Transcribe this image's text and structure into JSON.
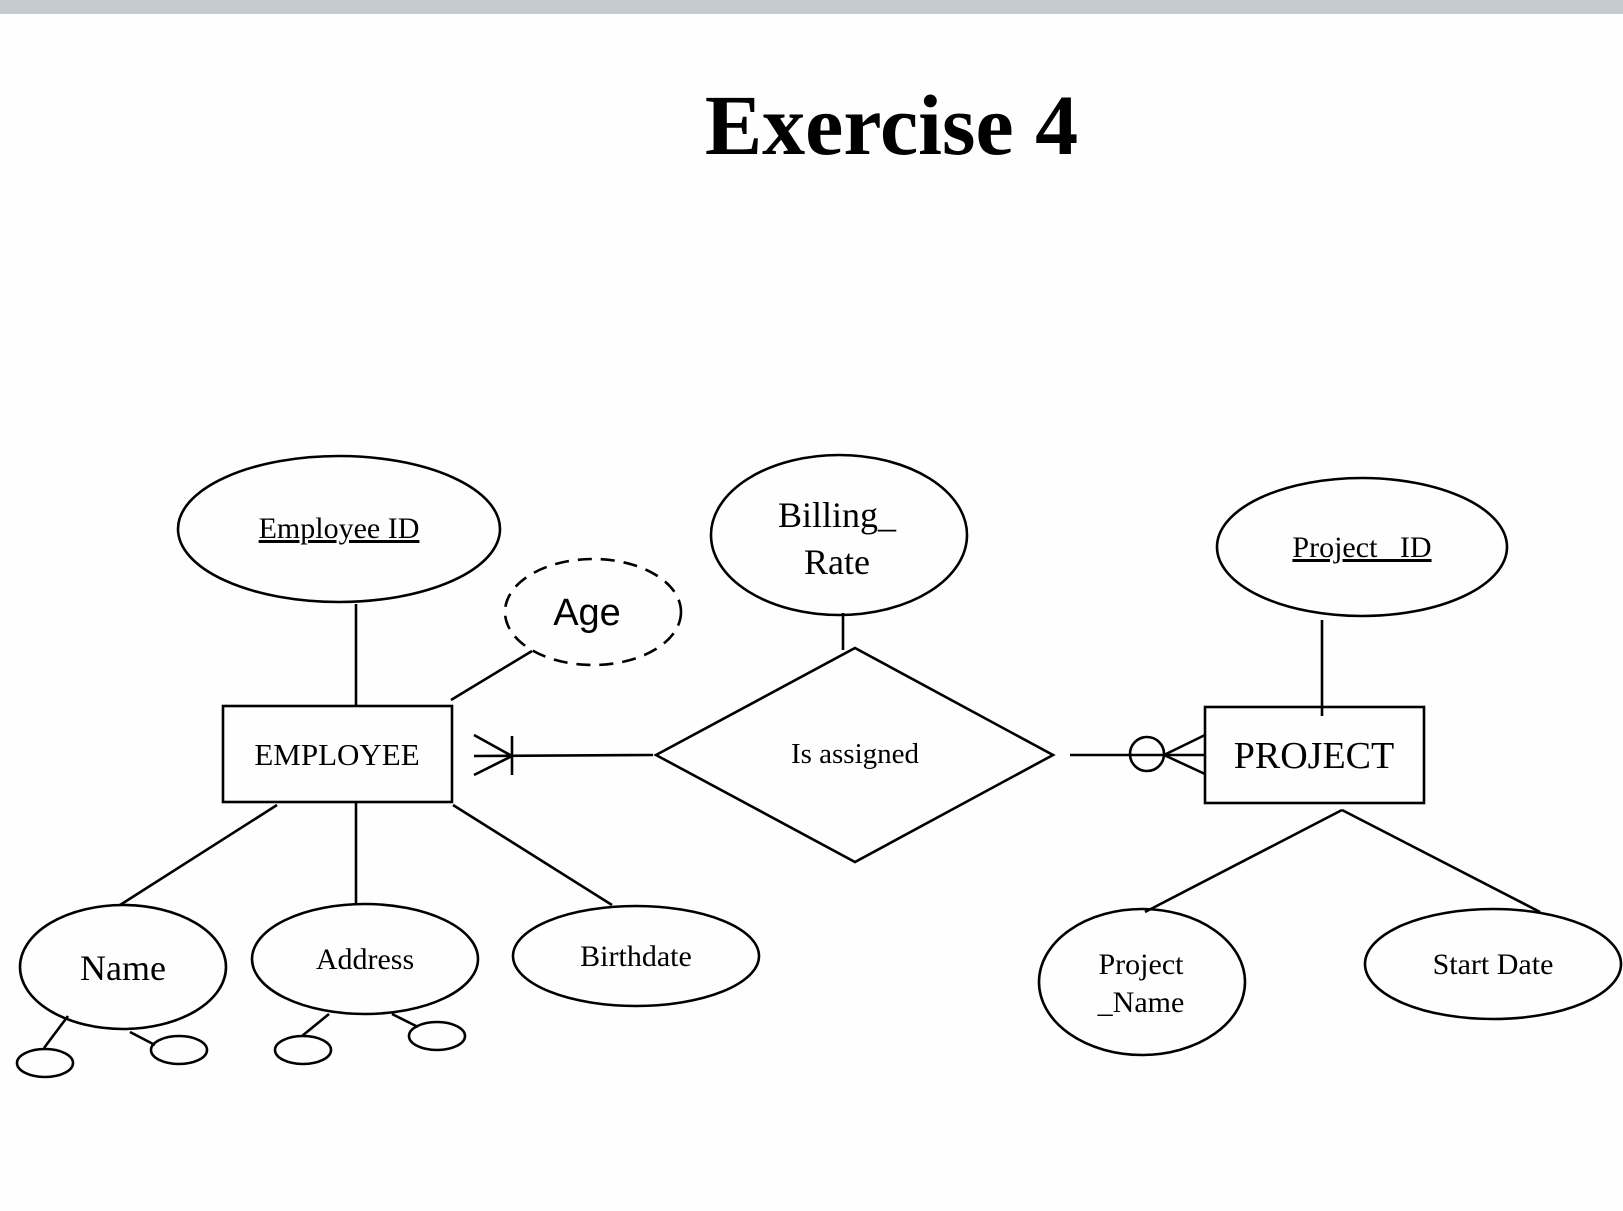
{
  "slide": {
    "title": "Exercise 4"
  },
  "diagram": {
    "entities": [
      {
        "id": "employee",
        "label": "EMPLOYEE"
      },
      {
        "id": "project",
        "label": "PROJECT"
      }
    ],
    "relationship": {
      "label": "Is assigned",
      "employee_side_cardinality": "one-or-many",
      "project_side_cardinality": "zero-or-many",
      "attribute": {
        "line1": "Billing_",
        "line2": "Rate"
      }
    },
    "employee_attributes": {
      "key": "Employee ID",
      "derived": "Age",
      "composite_name": "Name",
      "composite_address": "Address",
      "birthdate": "Birthdate"
    },
    "project_attributes": {
      "key": "Project_ ID",
      "name_line1": "Project",
      "name_line2": "_Name",
      "start_date": "Start Date"
    }
  }
}
